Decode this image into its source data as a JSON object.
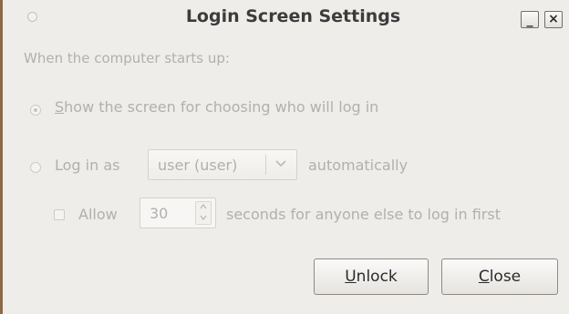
{
  "window": {
    "title": "Login Screen Settings",
    "minimize_label": "_",
    "close_label": "×"
  },
  "intro_text": "When the computer starts up:",
  "option_show_screen": {
    "mnemonic": "S",
    "label_rest": "how the screen for choosing who will log in",
    "checked": true
  },
  "option_auto_login": {
    "label": "Log in as",
    "user_select_value": "user (user)",
    "suffix": "automatically",
    "checked": false
  },
  "allow_delay": {
    "label": "Allow",
    "seconds_value": "30",
    "suffix": "seconds for anyone else to log in first",
    "checked": false
  },
  "buttons": {
    "unlock_mnemonic": "U",
    "unlock_rest": "nlock",
    "close_mnemonic": "C",
    "close_rest": "lose"
  },
  "icons": {
    "combo_arrow": "chevron-down-icon",
    "spin_up": "spin-up-icon",
    "spin_down": "spin-down-icon",
    "window_menu": "window-menu-icon"
  },
  "colors": {
    "window_bg": "#efedea",
    "disabled_text": "#b3b0ab",
    "title_text": "#3c3c3c"
  }
}
